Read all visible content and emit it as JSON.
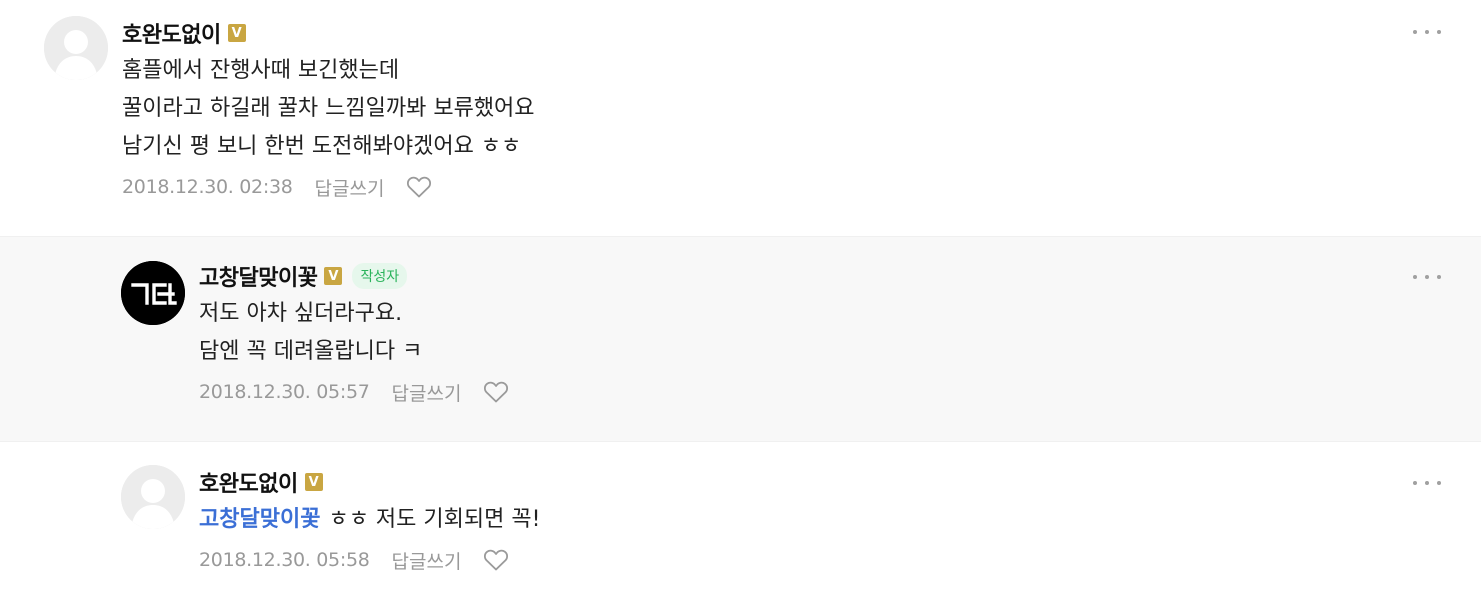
{
  "comments": [
    {
      "nickname": "호완도없이",
      "badge": "V",
      "lines": [
        "홈플에서 잔행사때 보긴했는데",
        "꿀이라고 하길래 꿀차 느낌일까봐 보류했어요",
        "남기신 평 보니 한번 도전해봐야겠어요 ㅎㅎ"
      ],
      "date": "2018.12.30. 02:38",
      "reply_label": "답글쓰기"
    },
    {
      "nickname": "고창달맞이꽃",
      "badge": "V",
      "author_tag": "작성자",
      "lines": [
        "저도 아차 싶더라구요.",
        "담엔 꼭 데려올랍니다 ㅋ"
      ],
      "date": "2018.12.30. 05:57",
      "reply_label": "답글쓰기"
    },
    {
      "nickname": "호완도없이",
      "badge": "V",
      "mention": "고창달맞이꽃",
      "text": "ㅎㅎ 저도 기회되면 꼭!",
      "date": "2018.12.30. 05:58",
      "reply_label": "답글쓰기"
    }
  ],
  "colors": {
    "badge": "#c9a642",
    "author_tag_bg": "#e6f7ec",
    "author_tag_text": "#2ab35b",
    "mention": "#3b6fd6",
    "reply_bg": "#f8f8f8",
    "meta_text": "#999999"
  },
  "icons": {
    "more": "more-dots-icon",
    "like": "heart-icon",
    "avatar_default": "default-avatar-icon",
    "avatar_logo": "gd-logo-avatar"
  }
}
